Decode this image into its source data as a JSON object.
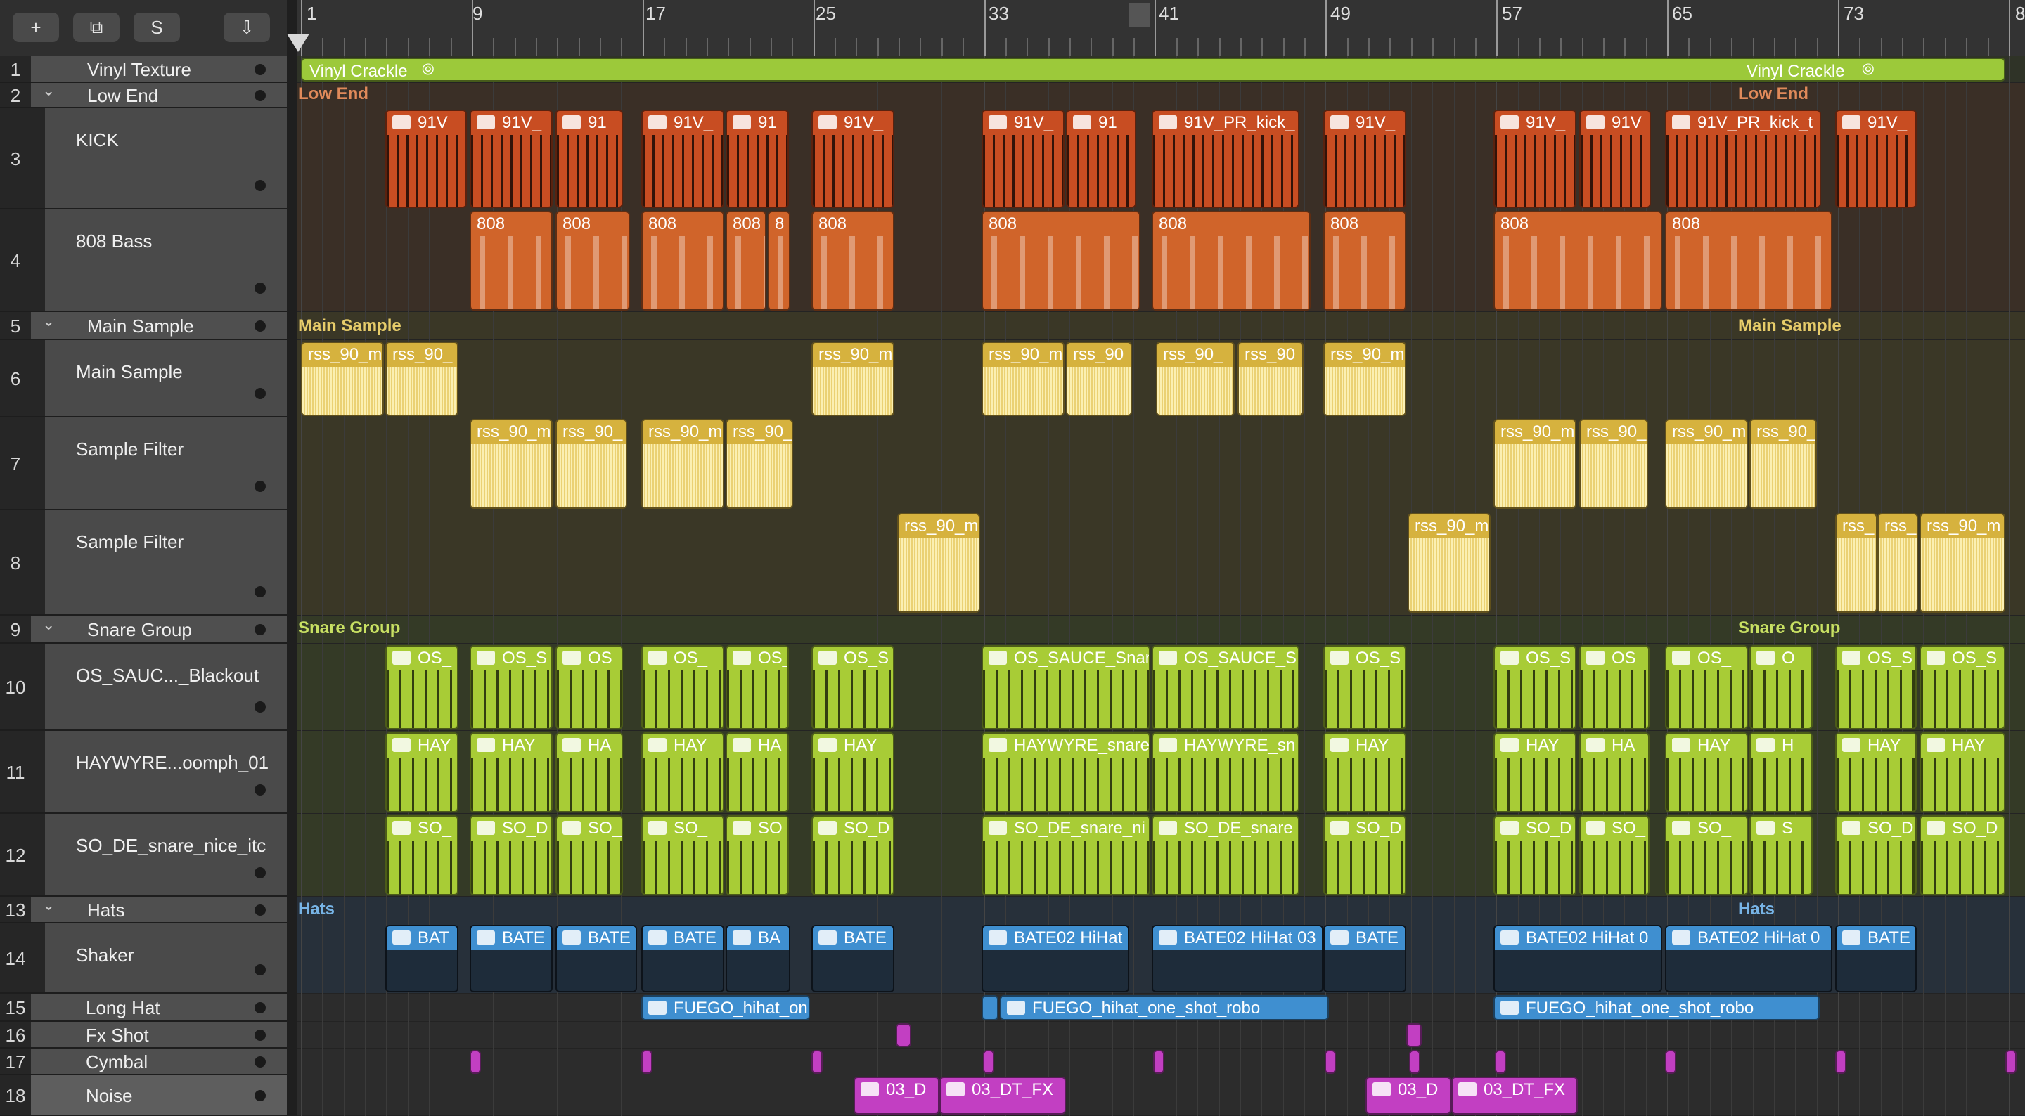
{
  "toolbar": {
    "buttons": [
      {
        "label": "+",
        "icon": "plus-icon"
      },
      {
        "label": "⧉",
        "icon": "duplicate-icon"
      },
      {
        "label": "S",
        "icon": "solo-icon"
      },
      {
        "label": "⇩",
        "icon": "download-icon"
      }
    ]
  },
  "ruler": {
    "bar_labels": [
      "1",
      "9",
      "17",
      "25",
      "33",
      "41",
      "49",
      "57",
      "65",
      "73",
      "8"
    ]
  },
  "tracks": [
    {
      "num": "1",
      "name": "Vinyl Texture",
      "type": "track"
    },
    {
      "num": "2",
      "name": "Low End",
      "type": "folder"
    },
    {
      "num": "3",
      "name": "KICK",
      "type": "sub"
    },
    {
      "num": "4",
      "name": "808 Bass",
      "type": "sub"
    },
    {
      "num": "5",
      "name": "Main Sample",
      "type": "folder"
    },
    {
      "num": "6",
      "name": "Main Sample",
      "type": "sub"
    },
    {
      "num": "7",
      "name": "Sample Filter",
      "type": "sub"
    },
    {
      "num": "8",
      "name": "Sample Filter",
      "type": "sub"
    },
    {
      "num": "9",
      "name": "Snare Group",
      "type": "folder"
    },
    {
      "num": "10",
      "name": "OS_SAUC..._Blackout",
      "type": "sub"
    },
    {
      "num": "11",
      "name": "HAYWYRE...oomph_01",
      "type": "sub"
    },
    {
      "num": "12",
      "name": "SO_DE_snare_nice_itc",
      "type": "sub"
    },
    {
      "num": "13",
      "name": "Hats",
      "type": "folder"
    },
    {
      "num": "14",
      "name": "Shaker",
      "type": "sub"
    },
    {
      "num": "15",
      "name": "Long Hat",
      "type": "track"
    },
    {
      "num": "16",
      "name": "Fx Shot",
      "type": "track"
    },
    {
      "num": "17",
      "name": "Cymbal",
      "type": "track"
    },
    {
      "num": "18",
      "name": "Noise",
      "type": "track",
      "selected": true
    }
  ],
  "folder_labels": {
    "low_end": [
      "Low End",
      "Low End"
    ],
    "main_sample": [
      "Main Sample",
      "Main Sample"
    ],
    "snare_group": [
      "Snare Group",
      "Snare Group"
    ],
    "hats": [
      "Hats",
      "Hats"
    ]
  },
  "regions": {
    "vinyl": [
      "Vinyl Crackle",
      "Vinyl Crackle"
    ],
    "kick": [
      "91V",
      "91V_",
      "91",
      "91V_",
      "91",
      "91V_",
      "91V_",
      "91",
      "91V_PR_kick_",
      "91V_",
      "91V_",
      "91V",
      "91V_PR_kick_t",
      "91V_"
    ],
    "bass": [
      "808",
      "808",
      "808",
      "808",
      "8",
      "808",
      "808",
      "808",
      "808",
      "808",
      "808"
    ],
    "main_sample": [
      "rss_90_m",
      "rss_90_",
      "rss_90_m",
      "rss_90_m",
      "rss_90",
      "rss_90_",
      "rss_90",
      "rss_90_m"
    ],
    "filter1": [
      "rss_90_m",
      "rss_90_",
      "rss_90_m",
      "rss_90_",
      "rss_90_m",
      "rss_90_",
      "rss_90_m",
      "rss_90_"
    ],
    "filter2": [
      "rss_90_m",
      "rss_90_m",
      "rss_",
      "rss_",
      "rss_90_m"
    ],
    "snare_os": [
      "OS_",
      "OS_S",
      "OS",
      "OS_",
      "OS_",
      "OS_S",
      "OS_SAUCE_Snar",
      "OS_SAUCE_S",
      "OS_S",
      "OS_S",
      "OS",
      "OS_",
      "O",
      "OS_S",
      "OS_S"
    ],
    "snare_hay": [
      "HAY",
      "HAY",
      "HA",
      "HAY",
      "HA",
      "HAY",
      "HAYWYRE_snare",
      "HAYWYRE_sn",
      "HAY",
      "HAY",
      "HA",
      "HAY",
      "H",
      "HAY",
      "HAY"
    ],
    "snare_so": [
      "SO_",
      "SO_D",
      "SO_",
      "SO_",
      "SO",
      "SO_D",
      "SO_DE_snare_ni",
      "SO_DE_snare",
      "SO_D",
      "SO_D",
      "SO_",
      "SO_",
      "S",
      "SO_D",
      "SO_D"
    ],
    "shaker": [
      "BAT",
      "BATE",
      "BATE",
      "BATE",
      "BA",
      "BATE",
      "BATE02 HiHat",
      "BATE02 HiHat 03",
      "BATE",
      "BATE02 HiHat 0",
      "BATE02 HiHat 0",
      "BATE"
    ],
    "longhat": [
      "FUEGO_hihat_on",
      "FUEGO_hihat_one_shot_robo",
      "FUEGO_hihat_one_shot_robo"
    ],
    "noise": [
      "03_D",
      "03_DT_FX",
      "03_D",
      "03_DT_FX"
    ]
  },
  "colors": {
    "vinyl": "#9cc93a",
    "kick": "#c84d22",
    "bass": "#d0642a",
    "sample": "#d6b23e",
    "snare": "#a8cc36",
    "hats": "#3f8fd0",
    "fx": "#c23fc2",
    "folder_label_low": "#e08a5a",
    "folder_label_sample": "#e7cc6a",
    "folder_label_snare": "#c8e063",
    "folder_label_hats": "#77b4e6"
  }
}
